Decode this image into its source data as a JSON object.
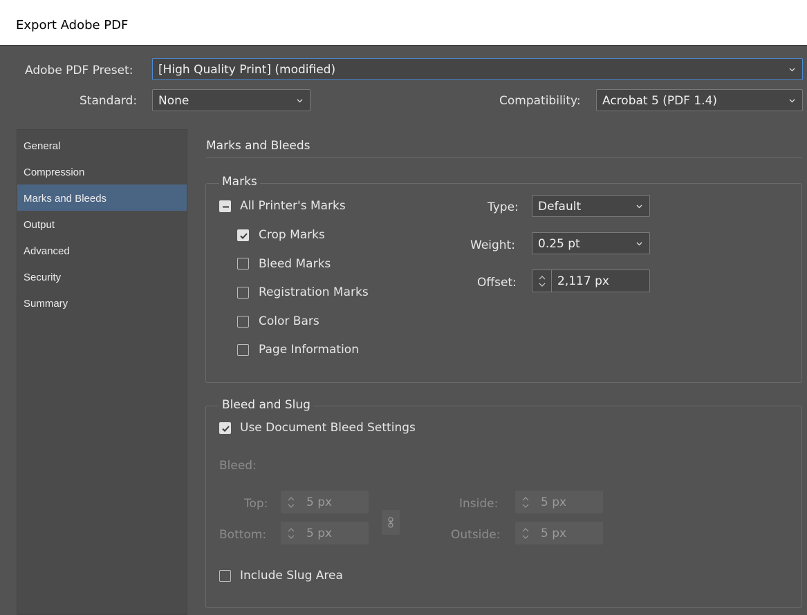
{
  "window": {
    "title": "Export Adobe PDF"
  },
  "preset": {
    "label": "Adobe PDF Preset:",
    "value": "[High Quality Print] (modified)"
  },
  "standard": {
    "label": "Standard:",
    "value": "None"
  },
  "compatibility": {
    "label": "Compatibility:",
    "value": "Acrobat 5 (PDF 1.4)"
  },
  "sidebar": {
    "items": [
      {
        "label": "General"
      },
      {
        "label": "Compression"
      },
      {
        "label": "Marks and Bleeds",
        "selected": true
      },
      {
        "label": "Output"
      },
      {
        "label": "Advanced"
      },
      {
        "label": "Security"
      },
      {
        "label": "Summary"
      }
    ]
  },
  "section": {
    "title": "Marks and Bleeds"
  },
  "marks": {
    "group_title": "Marks",
    "all_printers_marks": {
      "label": "All Printer's Marks",
      "state": "mixed"
    },
    "crop_marks": {
      "label": "Crop Marks",
      "checked": true
    },
    "bleed_marks": {
      "label": "Bleed Marks",
      "checked": false
    },
    "registration_marks": {
      "label": "Registration Marks",
      "checked": false
    },
    "color_bars": {
      "label": "Color Bars",
      "checked": false
    },
    "page_information": {
      "label": "Page Information",
      "checked": false
    },
    "type": {
      "label": "Type:",
      "value": "Default"
    },
    "weight": {
      "label": "Weight:",
      "value": "0.25 pt"
    },
    "offset": {
      "label": "Offset:",
      "value": "2,117 px"
    }
  },
  "bleed_slug": {
    "group_title": "Bleed and Slug",
    "use_document_bleed": {
      "label": "Use Document Bleed Settings",
      "checked": true
    },
    "bleed_label": "Bleed:",
    "top": {
      "label": "Top:",
      "value": "5 px"
    },
    "bottom": {
      "label": "Bottom:",
      "value": "5 px"
    },
    "inside": {
      "label": "Inside:",
      "value": "5 px"
    },
    "outside": {
      "label": "Outside:",
      "value": "5 px"
    },
    "include_slug": {
      "label": "Include Slug Area",
      "checked": false
    }
  },
  "colors": {
    "background": "#535353",
    "sidebar": "#4b4b4b",
    "selection": "#4a6484",
    "focus_border": "#4d8ad4"
  }
}
